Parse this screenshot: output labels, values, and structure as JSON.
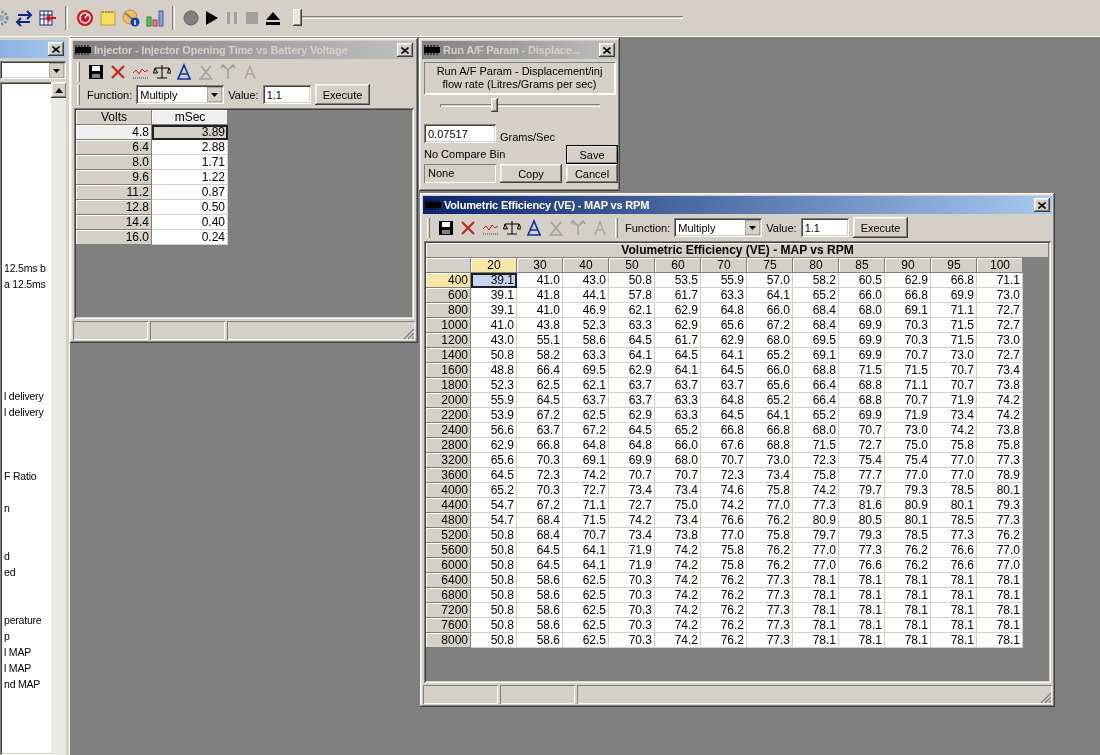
{
  "toolbar": {
    "slider": {
      "level": 0
    }
  },
  "side_panel": {
    "lines": [
      "12.5ms b",
      "a 12.5ms",
      "l delivery",
      "l delivery",
      "F Ratio",
      "n",
      "d",
      "ed",
      "perature",
      "p",
      "l MAP",
      "l MAP",
      "nd MAP"
    ]
  },
  "windows": [
    {
      "kind": "table",
      "title": "Injector - Injector Opening Time vs Battery Voltage",
      "active": false,
      "toolbar": {
        "function_label": "Function:",
        "function": "Multiply",
        "value_label": "Value:",
        "value": "1.1",
        "execute": "Execute"
      },
      "table": {
        "row_header": "Volts",
        "columns": [
          {
            "label": "mSec",
            "selected": true
          }
        ],
        "rows": [
          {
            "label": "4.8",
            "selected": true,
            "values": [
              "3.89"
            ]
          },
          {
            "label": "6.4",
            "selected": false,
            "values": [
              "2.88"
            ]
          },
          {
            "label": "8.0",
            "selected": false,
            "values": [
              "1.71"
            ]
          },
          {
            "label": "9.6",
            "selected": false,
            "values": [
              "1.22"
            ]
          },
          {
            "label": "11.2",
            "selected": false,
            "values": [
              "0.87"
            ]
          },
          {
            "label": "12.8",
            "selected": false,
            "values": [
              "0.50"
            ]
          },
          {
            "label": "14.4",
            "selected": false,
            "values": [
              "0.40"
            ]
          },
          {
            "label": "16.0",
            "selected": false,
            "values": [
              "0.24"
            ]
          }
        ]
      }
    },
    {
      "kind": "param",
      "title": "Run A/F Param - Displace...",
      "active": false,
      "description": "Run A/F Param - Displacement/inj flow rate (Litres/Grams per sec)",
      "slider": {
        "level": 0.34
      },
      "value": "0.07517",
      "unit": "Grams/Sec",
      "compare_label": "No Compare Bin",
      "compare_value": "None",
      "buttons": [
        {
          "kind": "copy",
          "label": "Copy",
          "default": false
        },
        {
          "kind": "save",
          "label": "Save",
          "default": true
        },
        {
          "kind": "cancel",
          "label": "Cancel",
          "default": false
        }
      ]
    },
    {
      "kind": "table",
      "title": "Volumetric Efficiency (VE) - MAP vs RPM",
      "active": true,
      "toolbar": {
        "function_label": "Function:",
        "function": "Multiply",
        "value_label": "Value:",
        "value": "1.1",
        "execute": "Execute"
      },
      "table": {
        "title": "Volumetric Efficiency (VE) - MAP vs RPM",
        "columns": [
          {
            "label": "20",
            "selected": true
          },
          {
            "label": "30",
            "selected": false
          },
          {
            "label": "40",
            "selected": false
          },
          {
            "label": "50",
            "selected": false
          },
          {
            "label": "60",
            "selected": false
          },
          {
            "label": "70",
            "selected": false
          },
          {
            "label": "75",
            "selected": false
          },
          {
            "label": "80",
            "selected": false
          },
          {
            "label": "85",
            "selected": false
          },
          {
            "label": "90",
            "selected": false
          },
          {
            "label": "95",
            "selected": false
          },
          {
            "label": "100",
            "selected": false
          }
        ],
        "rows": [
          {
            "label": "400",
            "selected": true,
            "values": [
              "39.1",
              "41.0",
              "43.0",
              "50.8",
              "53.5",
              "55.9",
              "57.0",
              "58.2",
              "60.5",
              "62.9",
              "66.8",
              "71.1"
            ]
          },
          {
            "label": "600",
            "selected": false,
            "values": [
              "39.1",
              "41.8",
              "44.1",
              "57.8",
              "61.7",
              "63.3",
              "64.1",
              "65.2",
              "66.0",
              "66.8",
              "69.9",
              "73.0"
            ]
          },
          {
            "label": "800",
            "selected": false,
            "values": [
              "39.1",
              "41.0",
              "46.9",
              "62.1",
              "62.9",
              "64.8",
              "66.0",
              "68.4",
              "68.0",
              "69.1",
              "71.1",
              "72.7"
            ]
          },
          {
            "label": "1000",
            "selected": false,
            "values": [
              "41.0",
              "43.8",
              "52.3",
              "63.3",
              "62.9",
              "65.6",
              "67.2",
              "68.4",
              "69.9",
              "70.3",
              "71.5",
              "72.7"
            ]
          },
          {
            "label": "1200",
            "selected": false,
            "values": [
              "43.0",
              "55.1",
              "58.6",
              "64.5",
              "61.7",
              "62.9",
              "68.0",
              "69.5",
              "69.9",
              "70.3",
              "71.5",
              "73.0"
            ]
          },
          {
            "label": "1400",
            "selected": false,
            "values": [
              "50.8",
              "58.2",
              "63.3",
              "64.1",
              "64.5",
              "64.1",
              "65.2",
              "69.1",
              "69.9",
              "70.7",
              "73.0",
              "72.7"
            ]
          },
          {
            "label": "1600",
            "selected": false,
            "values": [
              "48.8",
              "66.4",
              "69.5",
              "62.9",
              "64.1",
              "64.5",
              "66.0",
              "68.8",
              "71.5",
              "71.5",
              "70.7",
              "73.4"
            ]
          },
          {
            "label": "1800",
            "selected": false,
            "values": [
              "52.3",
              "62.5",
              "62.1",
              "63.7",
              "63.7",
              "63.7",
              "65.6",
              "66.4",
              "68.8",
              "71.1",
              "70.7",
              "73.8"
            ]
          },
          {
            "label": "2000",
            "selected": false,
            "values": [
              "55.9",
              "64.5",
              "63.7",
              "63.7",
              "63.3",
              "64.8",
              "65.2",
              "66.4",
              "68.8",
              "70.7",
              "71.9",
              "74.2"
            ]
          },
          {
            "label": "2200",
            "selected": false,
            "values": [
              "53.9",
              "67.2",
              "62.5",
              "62.9",
              "63.3",
              "64.5",
              "64.1",
              "65.2",
              "69.9",
              "71.9",
              "73.4",
              "74.2"
            ]
          },
          {
            "label": "2400",
            "selected": false,
            "values": [
              "56.6",
              "63.7",
              "67.2",
              "64.5",
              "65.2",
              "66.8",
              "66.8",
              "68.0",
              "70.7",
              "73.0",
              "74.2",
              "73.8"
            ]
          },
          {
            "label": "2800",
            "selected": false,
            "values": [
              "62.9",
              "66.8",
              "64.8",
              "64.8",
              "66.0",
              "67.6",
              "68.8",
              "71.5",
              "72.7",
              "75.0",
              "75.8",
              "75.8"
            ]
          },
          {
            "label": "3200",
            "selected": false,
            "values": [
              "65.6",
              "70.3",
              "69.1",
              "69.9",
              "68.0",
              "70.7",
              "73.0",
              "72.3",
              "75.4",
              "75.4",
              "77.0",
              "77.3"
            ]
          },
          {
            "label": "3600",
            "selected": false,
            "values": [
              "64.5",
              "72.3",
              "74.2",
              "70.7",
              "70.7",
              "72.3",
              "73.4",
              "75.8",
              "77.7",
              "77.0",
              "77.0",
              "78.9"
            ]
          },
          {
            "label": "4000",
            "selected": false,
            "values": [
              "65.2",
              "70.3",
              "72.7",
              "73.4",
              "73.4",
              "74.6",
              "75.8",
              "74.2",
              "79.7",
              "79.3",
              "78.5",
              "80.1"
            ]
          },
          {
            "label": "4400",
            "selected": false,
            "values": [
              "54.7",
              "67.2",
              "71.1",
              "72.7",
              "75.0",
              "74.2",
              "77.0",
              "77.3",
              "81.6",
              "80.9",
              "80.1",
              "79.3"
            ]
          },
          {
            "label": "4800",
            "selected": false,
            "values": [
              "54.7",
              "68.4",
              "71.5",
              "74.2",
              "73.4",
              "76.6",
              "76.2",
              "80.9",
              "80.5",
              "80.1",
              "78.5",
              "77.3"
            ]
          },
          {
            "label": "5200",
            "selected": false,
            "values": [
              "50.8",
              "68.4",
              "70.7",
              "73.4",
              "73.8",
              "77.0",
              "75.8",
              "79.7",
              "79.3",
              "78.5",
              "77.3",
              "76.2"
            ]
          },
          {
            "label": "5600",
            "selected": false,
            "values": [
              "50.8",
              "64.5",
              "64.1",
              "71.9",
              "74.2",
              "75.8",
              "76.2",
              "77.0",
              "77.3",
              "76.2",
              "76.6",
              "77.0"
            ]
          },
          {
            "label": "6000",
            "selected": false,
            "values": [
              "50.8",
              "64.5",
              "64.1",
              "71.9",
              "74.2",
              "75.8",
              "76.2",
              "77.0",
              "76.6",
              "76.2",
              "76.6",
              "77.0"
            ]
          },
          {
            "label": "6400",
            "selected": false,
            "values": [
              "50.8",
              "58.6",
              "62.5",
              "70.3",
              "74.2",
              "76.2",
              "77.3",
              "78.1",
              "78.1",
              "78.1",
              "78.1",
              "78.1"
            ]
          },
          {
            "label": "6800",
            "selected": false,
            "values": [
              "50.8",
              "58.6",
              "62.5",
              "70.3",
              "74.2",
              "76.2",
              "77.3",
              "78.1",
              "78.1",
              "78.1",
              "78.1",
              "78.1"
            ]
          },
          {
            "label": "7200",
            "selected": false,
            "values": [
              "50.8",
              "58.6",
              "62.5",
              "70.3",
              "74.2",
              "76.2",
              "77.3",
              "78.1",
              "78.1",
              "78.1",
              "78.1",
              "78.1"
            ]
          },
          {
            "label": "7600",
            "selected": false,
            "values": [
              "50.8",
              "58.6",
              "62.5",
              "70.3",
              "74.2",
              "76.2",
              "77.3",
              "78.1",
              "78.1",
              "78.1",
              "78.1",
              "78.1"
            ]
          },
          {
            "label": "8000",
            "selected": false,
            "values": [
              "50.8",
              "58.6",
              "62.5",
              "70.3",
              "74.2",
              "76.2",
              "77.3",
              "78.1",
              "78.1",
              "78.1",
              "78.1",
              "78.1"
            ]
          }
        ]
      }
    }
  ]
}
